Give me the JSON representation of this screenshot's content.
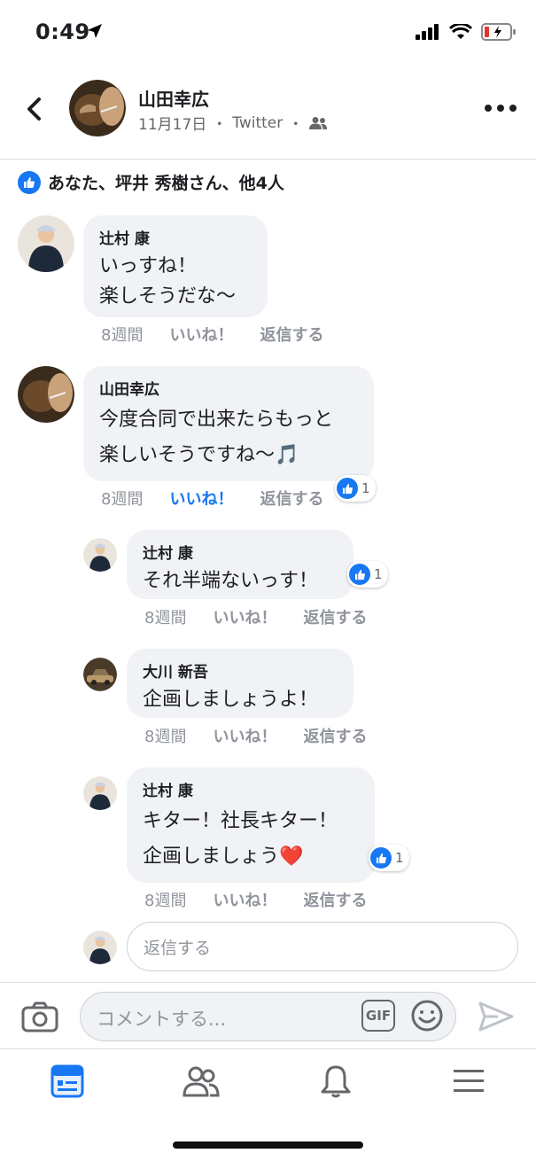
{
  "status_bar": {
    "time": "0:49"
  },
  "post_header": {
    "author": "山田幸広",
    "date": "11月17日",
    "source": "Twitter",
    "separator": "・"
  },
  "likes_summary": "あなた、坪井 秀樹さん、他4人",
  "comments": [
    {
      "author": "辻村 康",
      "text": "いっすね！\n楽しそうだな〜",
      "age": "8週間",
      "like_label": "いいね！",
      "reply_label": "返信する"
    },
    {
      "author": "山田幸広",
      "text": "今度合同で出来たらもっと\n楽しいそうですね〜🎵",
      "age": "8週間",
      "like_label": "いいね！",
      "reply_label": "返信する",
      "reactions": "1"
    },
    {
      "author": "辻村 康",
      "text": "それ半端ないっす！",
      "age": "8週間",
      "like_label": "いいね！",
      "reply_label": "返信する",
      "reactions": "1"
    },
    {
      "author": "大川 新吾",
      "text": "企画しましょうよ！",
      "age": "8週間",
      "like_label": "いいね！",
      "reply_label": "返信する"
    },
    {
      "author": "辻村 康",
      "text": "キター！社長キター！\n企画しましょう❤️",
      "age": "8週間",
      "like_label": "いいね！",
      "reply_label": "返信する",
      "reactions": "1"
    }
  ],
  "reply_placeholder": "返信する",
  "composer": {
    "placeholder": "コメントする...",
    "gif_label": "GIF"
  },
  "colors": {
    "accent": "#1877f2",
    "bubble": "#f0f2f5",
    "meta": "#90949c"
  },
  "icons": [
    "location-arrow-icon",
    "signal-icon",
    "wifi-icon",
    "battery-icon",
    "back-icon",
    "friends-icon",
    "more-icon",
    "like-icon",
    "camera-icon",
    "emoji-icon",
    "send-icon",
    "news-feed-icon",
    "friends-tab-icon",
    "bell-icon",
    "menu-icon"
  ]
}
